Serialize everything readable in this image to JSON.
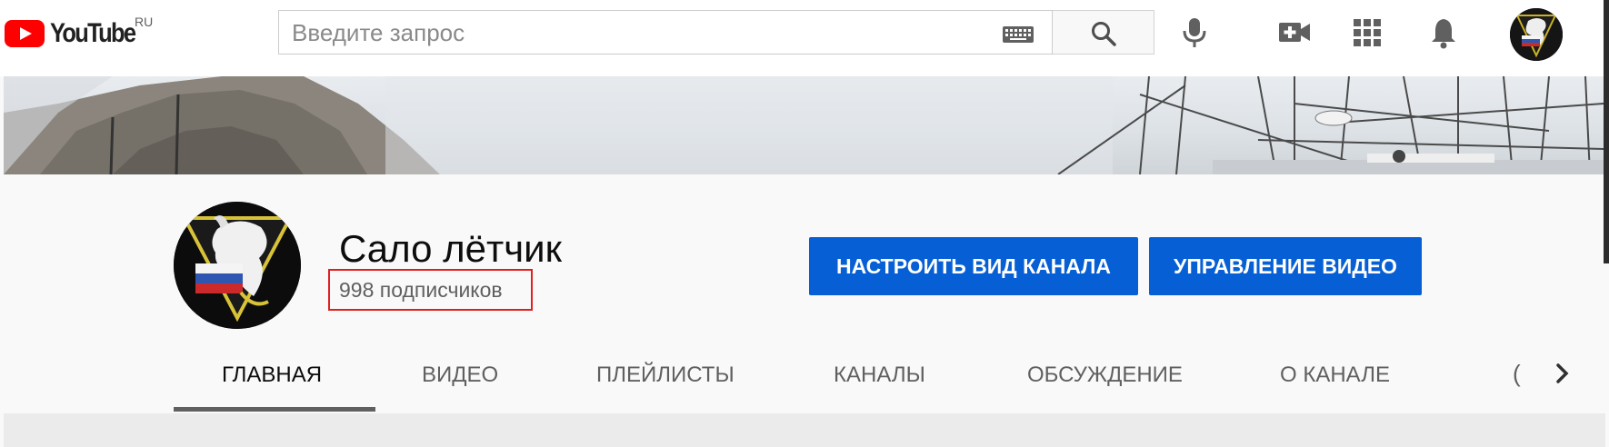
{
  "colors": {
    "youtube_red": "#ff0000",
    "button_blue": "#065fd4",
    "highlight_box": "#e02020",
    "page_background": "#f9f9f9"
  },
  "header": {
    "logo_text": "YouTube",
    "region": "RU",
    "search": {
      "placeholder": "Введите запрос",
      "value": ""
    },
    "icons": [
      "keyboard-icon",
      "search-icon",
      "microphone-icon",
      "create-video-icon",
      "apps-icon",
      "notifications-icon",
      "account-avatar"
    ]
  },
  "channel": {
    "name": "Сало лётчик",
    "subscribers": "998 подписчиков",
    "customize_label": "НАСТРОИТЬ ВИД КАНАЛА",
    "manage_label": "УПРАВЛЕНИЕ ВИДЕО"
  },
  "tabs": [
    {
      "label": "ГЛАВНАЯ",
      "active": true
    },
    {
      "label": "ВИДЕО",
      "active": false
    },
    {
      "label": "ПЛЕЙЛИСТЫ",
      "active": false
    },
    {
      "label": "КАНАЛЫ",
      "active": false
    },
    {
      "label": "ОБСУЖДЕНИЕ",
      "active": false
    },
    {
      "label": "О КАНАЛЕ",
      "active": false
    }
  ],
  "tab_scroll_prev": "(",
  "tab_scroll_next_icon": "chevron-right-icon"
}
